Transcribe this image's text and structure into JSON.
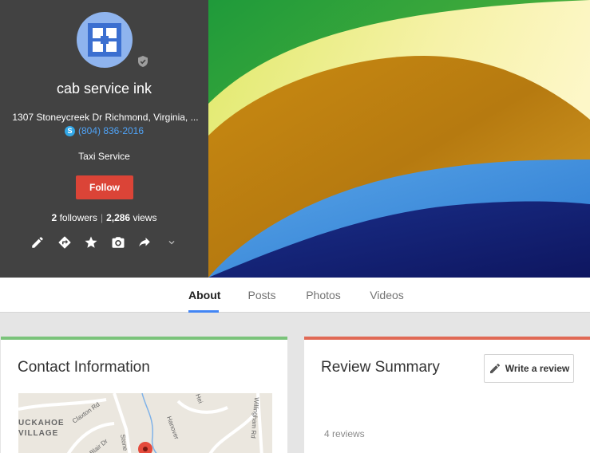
{
  "profile": {
    "name": "cab service ink",
    "address": "1307 Stoneycreek Dr Richmond, Virginia, ...",
    "phone": "(804) 836-2016",
    "category": "Taxi Service",
    "follow_label": "Follow",
    "followers_count": "2",
    "followers_label": "followers",
    "stats_separator": "|",
    "views_count": "2,286",
    "views_label": "views",
    "icons": [
      "pencil-icon",
      "directions-icon",
      "star-icon",
      "camera-icon",
      "share-icon",
      "chevron-down-icon"
    ]
  },
  "tabs": [
    {
      "label": "About",
      "active": true
    },
    {
      "label": "Posts",
      "active": false
    },
    {
      "label": "Photos",
      "active": false
    },
    {
      "label": "Videos",
      "active": false
    }
  ],
  "contact": {
    "title": "Contact Information",
    "map_labels": [
      "UCKAHOE",
      "VILLAGE",
      "Claxton Rd",
      "Blair Dr",
      "Stone",
      "Willingham Rd",
      "Hanover",
      "Hei"
    ]
  },
  "review": {
    "title": "Review Summary",
    "write_label": "Write a review",
    "count": "4 reviews"
  },
  "colors": {
    "panel_bg": "#424242",
    "follow_red": "#db4437",
    "tab_blue": "#4285f4",
    "contact_accent": "#7ac37a",
    "review_accent": "#e06955",
    "phone_link": "#4fa3f7"
  }
}
